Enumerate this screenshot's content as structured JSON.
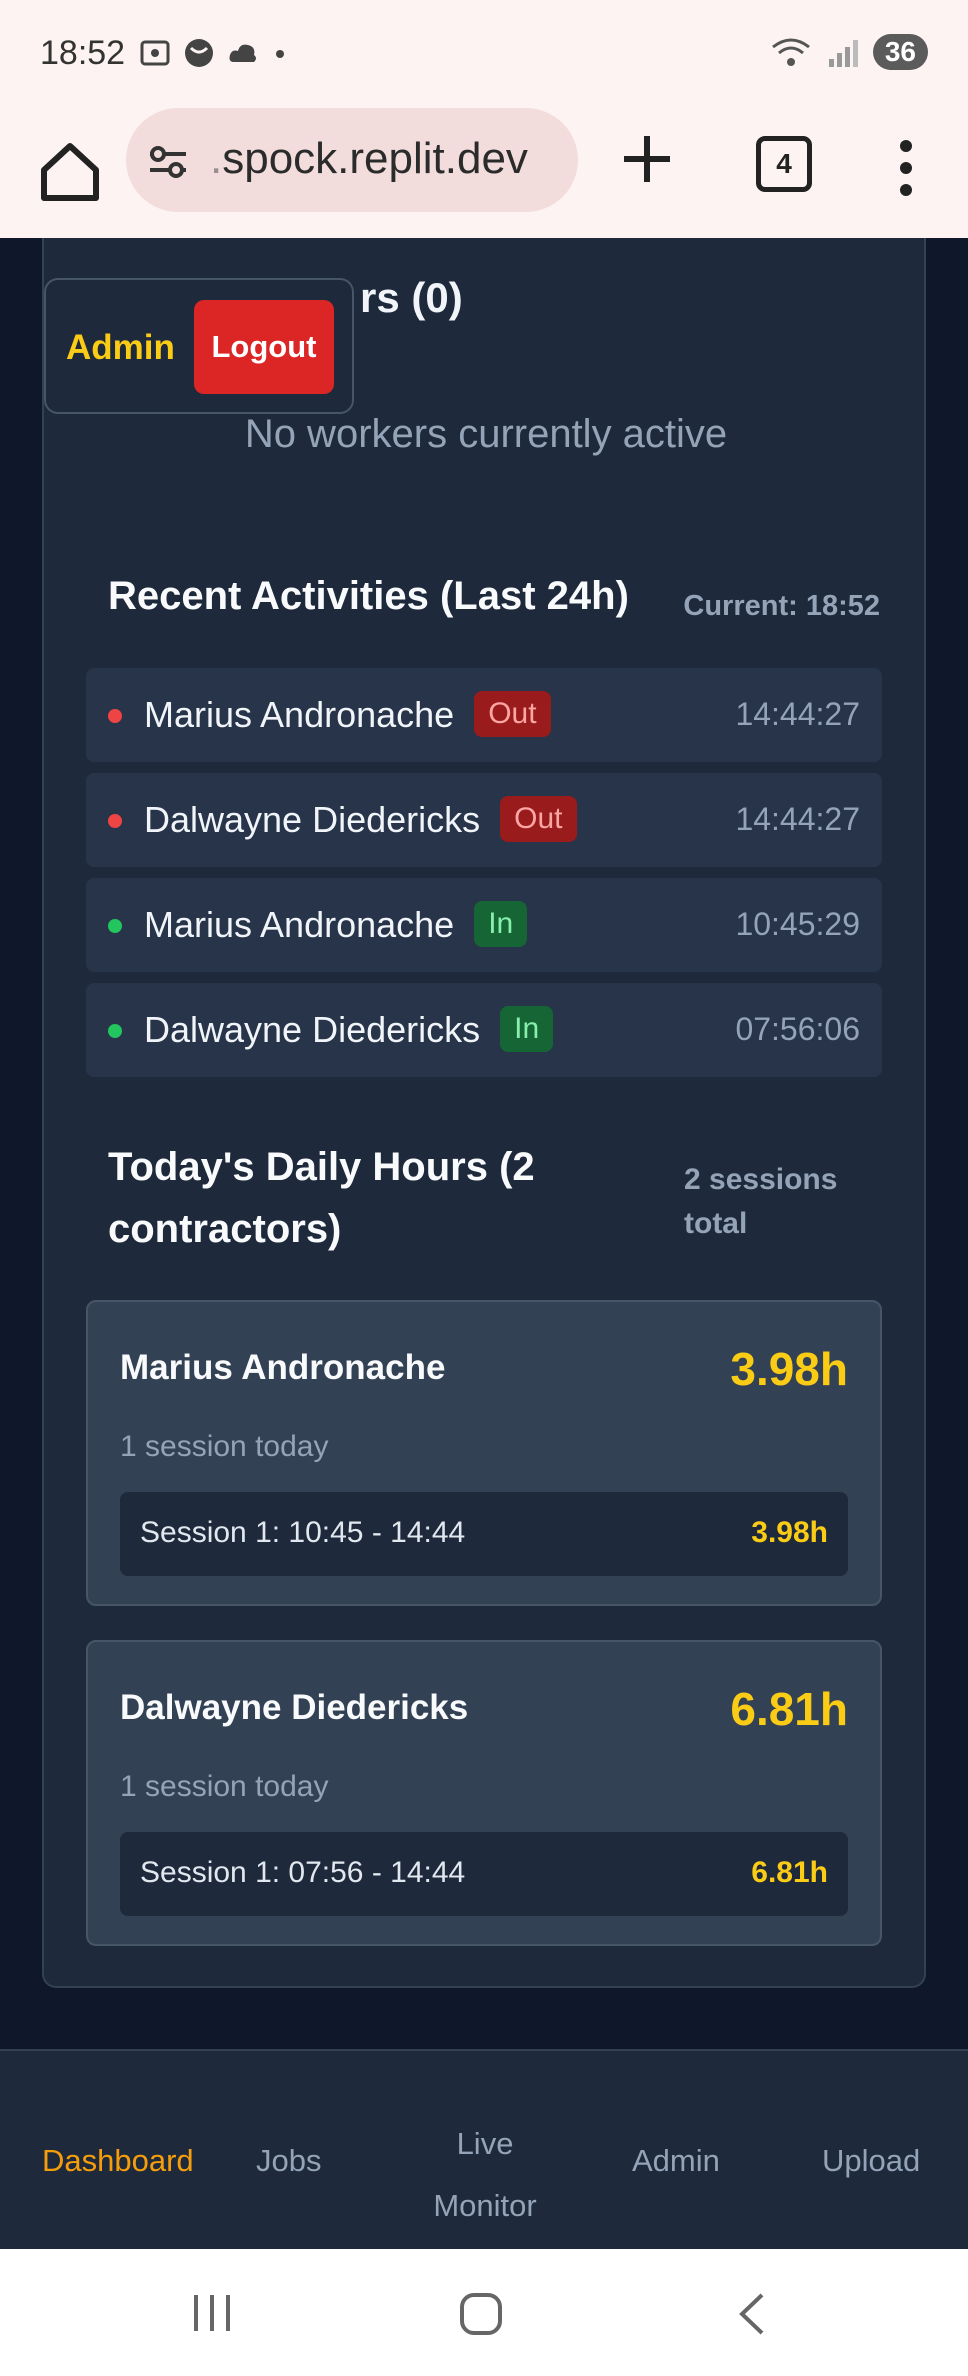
{
  "status_bar": {
    "time": "18:52",
    "battery": "36"
  },
  "browser": {
    "url_prefix": ".",
    "url_domain": "spock.replit.dev",
    "tab_count": "4"
  },
  "workers": {
    "title_visible": "rs (0)",
    "empty_text": "No workers currently active"
  },
  "admin_popup": {
    "admin_label": "Admin",
    "logout_label": "Logout"
  },
  "activities": {
    "title": "Recent Activities (Last 24h)",
    "current": "Current: 18:52",
    "items": [
      {
        "name": "Marius Andronache",
        "status": "Out",
        "time": "14:44:27"
      },
      {
        "name": "Dalwayne Diedericks",
        "status": "Out",
        "time": "14:44:27"
      },
      {
        "name": "Marius Andronache",
        "status": "In",
        "time": "10:45:29"
      },
      {
        "name": "Dalwayne Diedericks",
        "status": "In",
        "time": "07:56:06"
      }
    ]
  },
  "daily": {
    "title": "Today's Daily Hours (2 contractors)",
    "total": "2 sessions total",
    "contractors": [
      {
        "name": "Marius Andronache",
        "hours": "3.98h",
        "sessions_text": "1 session today",
        "session_label": "Session 1: 10:45 - 14:44",
        "session_hours": "3.98h"
      },
      {
        "name": "Dalwayne Diedericks",
        "hours": "6.81h",
        "sessions_text": "1 session today",
        "session_label": "Session 1: 07:56 - 14:44",
        "session_hours": "6.81h"
      }
    ]
  },
  "nav": {
    "dashboard": "Dashboard",
    "jobs": "Jobs",
    "live_monitor_line1": "Live",
    "live_monitor_line2": "Monitor",
    "admin": "Admin",
    "upload": "Upload"
  },
  "colors": {
    "accent": "#facc15",
    "danger": "#dc2626",
    "active_nav": "#f59e0b"
  }
}
